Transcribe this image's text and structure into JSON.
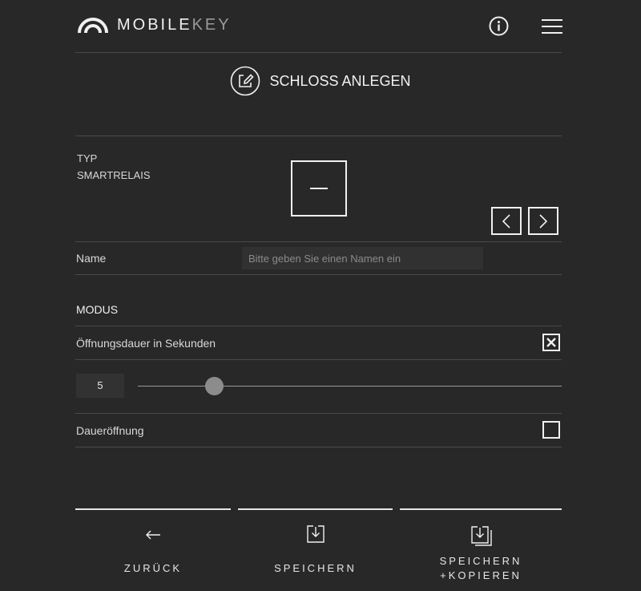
{
  "header": {
    "brand_primary": "MOBILE",
    "brand_secondary": "KEY",
    "logo_icon": "arc-logo-icon",
    "info_icon": "info-icon",
    "menu_icon": "hamburger-menu-icon"
  },
  "page": {
    "title": "SCHLOSS ANLEGEN",
    "title_icon": "edit-icon"
  },
  "typ": {
    "label": "TYP",
    "value": "SMARTRELAIS",
    "prev_icon": "chevron-left-icon",
    "next_icon": "chevron-right-icon"
  },
  "name": {
    "label": "Name",
    "placeholder": "Bitte geben Sie einen Namen ein",
    "value": ""
  },
  "modus": {
    "heading": "MODUS",
    "duration_label": "Öffnungsdauer in Sekunden",
    "duration_checked": true,
    "duration_value": "5",
    "permanent_label": "Daueröffnung",
    "permanent_checked": false
  },
  "actions": {
    "back_label": "ZURÜCK",
    "save_label": "SPEICHERN",
    "save_copy_line1": "SPEICHERN",
    "save_copy_line2": "+KOPIEREN"
  },
  "colors": {
    "background": "#282828",
    "foreground": "#f0f0f0",
    "divider": "#4a4a4a"
  }
}
